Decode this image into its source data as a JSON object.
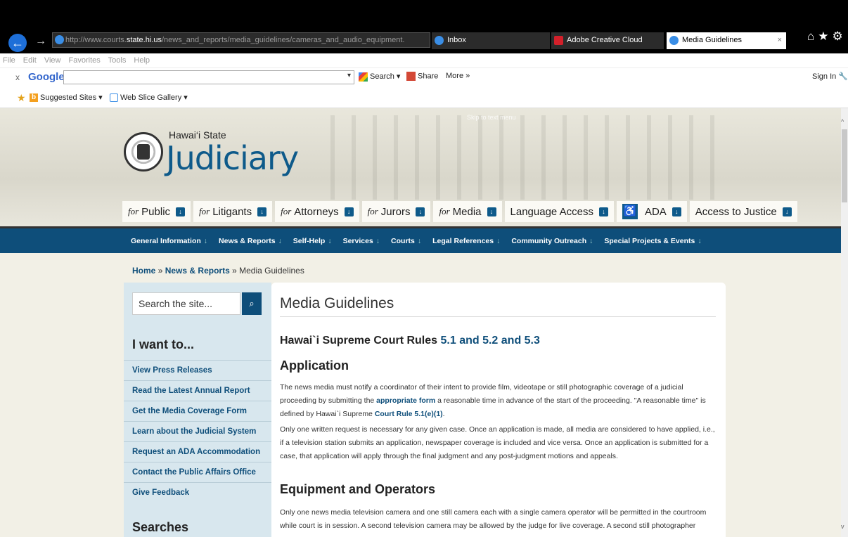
{
  "browser": {
    "url_prefix": "http://www.courts.",
    "url_host": "state.hi.us",
    "url_path": "/news_and_reports/media_guidelines/cameras_and_audio_equipment.",
    "addr_tools": "⌕ ▾ ↻",
    "tabs": [
      "Inbox",
      "Adobe Creative Cloud",
      "Media Guidelines"
    ],
    "tab_close": "×",
    "chrome_icons": "⌂★⚙"
  },
  "menu": [
    "File",
    "Edit",
    "View",
    "Favorites",
    "Tools",
    "Help"
  ],
  "google_bar": {
    "close": "x",
    "logo": "Google",
    "search": "Search ▾",
    "share": "Share",
    "more": "More »",
    "signin": "Sign In 🔧"
  },
  "favorites": {
    "suggested": "Suggested Sites ▾",
    "webslice": "Web Slice Gallery ▾"
  },
  "site": {
    "skip": "Skip to text menu",
    "state": "Hawai‘i State",
    "name": "Judiciary",
    "audience": [
      {
        "pre": "for",
        "label": "Public"
      },
      {
        "pre": "for",
        "label": "Litigants"
      },
      {
        "pre": "for",
        "label": "Attorneys"
      },
      {
        "pre": "for",
        "label": "Jurors"
      },
      {
        "pre": "for",
        "label": "Media"
      },
      {
        "pre": "",
        "label": "Language Access"
      },
      {
        "pre": "",
        "label": "ADA"
      },
      {
        "pre": "",
        "label": "Access to Justice"
      }
    ],
    "main_nav": [
      "General Information",
      "News & Reports",
      "Self-Help",
      "Services",
      "Courts",
      "Legal References",
      "Community Outreach",
      "Special Projects & Events"
    ],
    "breadcrumb": {
      "home": "Home",
      "sep": "»",
      "section": "News & Reports",
      "current": "Media Guidelines"
    }
  },
  "sidebar": {
    "search_placeholder": "Search the site...",
    "search_icon": "⌕",
    "i_want": "I want to...",
    "items": [
      "View Press Releases",
      "Read the Latest Annual Report",
      "Get the Media Coverage Form",
      "Learn about the Judicial System",
      "Request an ADA Accommodation",
      "Contact the Public Affairs Office",
      "Give Feedback"
    ],
    "searches": "Searches"
  },
  "content": {
    "title": "Media Guidelines",
    "rules_prefix": "Hawai`i Supreme Court Rules ",
    "rules_link": "5.1 and 5.2 and 5.3",
    "application_heading": "Application",
    "app_p1_a": "The news media must notify a coordinator of their intent to provide film, videotape or still photographic coverage of a judicial proceeding by submitting the ",
    "app_p1_link": "appropriate form",
    "app_p1_b": " a reasonable time in advance of the start of the proceeding. \"A reasonable time\" is defined by Hawai`i Supreme ",
    "app_p1_link2": "Court Rule 5.1(e)(1)",
    "app_p1_c": ".",
    "app_p2": "Only one written request is necessary for any given case. Once an application is made, all media are considered to have applied, i.e., if a television station submits an application, newspaper coverage is included and vice versa. Once an application is submitted for a case, that application will apply through the final judgment and any post-judgment motions and appeals.",
    "equip_heading": "Equipment and Operators",
    "equip_p1": "Only one news media television camera and one still camera each with a single camera operator will be permitted in the courtroom while court is in session. A second television camera may be allowed by the judge for live coverage. A second still photographer"
  }
}
